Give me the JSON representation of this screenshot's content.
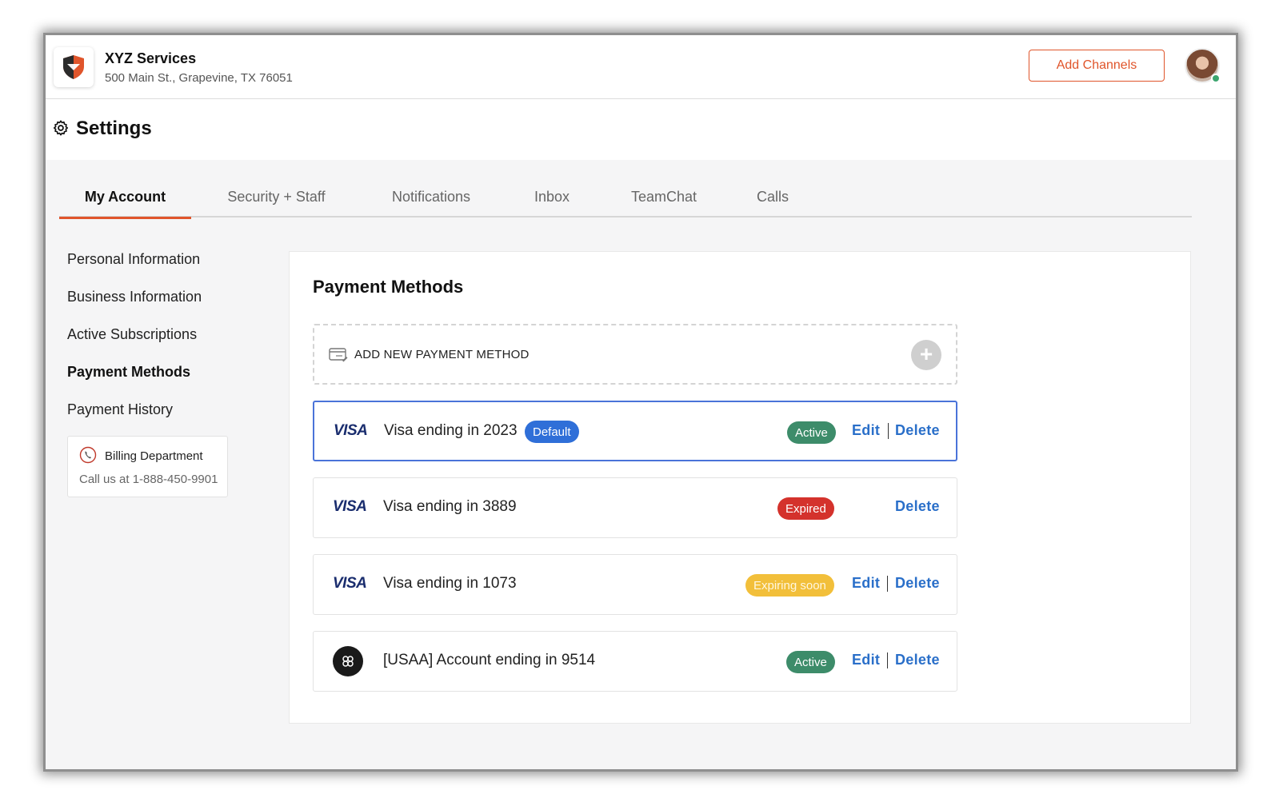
{
  "header": {
    "business_name": "XYZ Services",
    "business_address": "500 Main St., Grapevine, TX 76051",
    "add_channels_label": "Add Channels",
    "brand_color": "#e0552b"
  },
  "settings": {
    "title": "Settings"
  },
  "tabs": [
    {
      "label": "My Account",
      "active": true
    },
    {
      "label": "Security + Staff",
      "active": false
    },
    {
      "label": "Notifications",
      "active": false
    },
    {
      "label": "Inbox",
      "active": false
    },
    {
      "label": "TeamChat",
      "active": false
    },
    {
      "label": "Calls",
      "active": false
    }
  ],
  "sidebar": {
    "items": [
      {
        "label": "Personal Information",
        "active": false
      },
      {
        "label": "Business Information",
        "active": false
      },
      {
        "label": "Active Subscriptions",
        "active": false
      },
      {
        "label": "Payment Methods",
        "active": true
      },
      {
        "label": "Payment History",
        "active": false
      }
    ],
    "billing": {
      "title": "Billing Department",
      "phone_text": "Call us at 1-888-450-9901"
    }
  },
  "payment_methods": {
    "title": "Payment Methods",
    "add_new_label": "ADD NEW PAYMENT METHOD",
    "rows": [
      {
        "brand": "VISA",
        "label": "Visa ending in 2023",
        "default_badge": "Default",
        "status": "Active",
        "edit": "Edit",
        "delete": "Delete"
      },
      {
        "brand": "VISA",
        "label": "Visa ending in 3889",
        "status": "Expired",
        "delete": "Delete"
      },
      {
        "brand": "VISA",
        "label": "Visa ending in 1073",
        "status": "Expiring soon",
        "edit": "Edit",
        "delete": "Delete"
      },
      {
        "brand": "bank-icon",
        "label": "[USAA] Account ending in 9514",
        "status": "Active",
        "edit": "Edit",
        "delete": "Delete"
      }
    ]
  },
  "colors": {
    "active": "#3d8c6a",
    "expired": "#d4322c",
    "expiring_soon": "#f2bf3a",
    "default": "#2f6fd8",
    "link": "#2a6fc9"
  }
}
